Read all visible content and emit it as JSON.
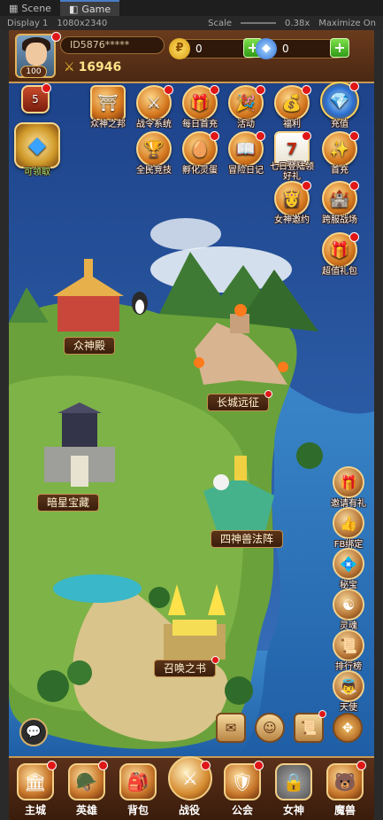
{
  "editor": {
    "tabs": [
      {
        "label": "Scene",
        "icon": "grid-icon"
      },
      {
        "label": "Game",
        "icon": "gamepad-icon"
      }
    ],
    "display": "Display 1",
    "resolution": "1080x2340",
    "scale_label": "Scale",
    "scale_value": "0.38x",
    "maximize": "Maximize On"
  },
  "player": {
    "name": "ID5876*****",
    "level": "100",
    "power": "16946",
    "vip": "5"
  },
  "currency": {
    "gold": "0",
    "diamond": "0"
  },
  "top_icons": [
    {
      "label": "众神之邦",
      "glyph": "⛩"
    },
    {
      "label": "战令系统",
      "glyph": "⚔"
    },
    {
      "label": "每日首充",
      "glyph": "🎁"
    },
    {
      "label": "活动",
      "glyph": "🎉"
    },
    {
      "label": "福利",
      "glyph": "💰"
    },
    {
      "label": "充值",
      "glyph": "💎"
    },
    {
      "label": "全民竞技",
      "glyph": "🏆"
    },
    {
      "label": "孵化灵蛋",
      "glyph": "🥚"
    },
    {
      "label": "冒险日记",
      "glyph": "📖"
    },
    {
      "label": "七日登陆领好礼",
      "glyph": "7"
    },
    {
      "label": "首充",
      "glyph": "✨"
    },
    {
      "label": "女神邀约",
      "glyph": "👸"
    },
    {
      "label": "跨服战场",
      "glyph": "🏰"
    },
    {
      "label": "超值礼包",
      "glyph": "🎁"
    }
  ],
  "left_icons": {
    "vip_label": "5",
    "shop_label": "可领取"
  },
  "map_locations": [
    {
      "label": "众神殿"
    },
    {
      "label": "长城远征"
    },
    {
      "label": "暗星宝藏"
    },
    {
      "label": "四神兽法阵"
    },
    {
      "label": "召唤之书"
    }
  ],
  "side_icons": [
    {
      "label": "邀请有礼",
      "glyph": "🎁"
    },
    {
      "label": "FB绑定",
      "glyph": "👍"
    },
    {
      "label": "秘宝",
      "glyph": "💠"
    },
    {
      "label": "灵魂",
      "glyph": "☯"
    },
    {
      "label": "排行榜",
      "glyph": "📜"
    },
    {
      "label": "天使",
      "glyph": "👼"
    }
  ],
  "bottom_nav": [
    {
      "label": "主城",
      "glyph": "🏛"
    },
    {
      "label": "英雄",
      "glyph": "🪖"
    },
    {
      "label": "背包",
      "glyph": "🎒"
    },
    {
      "label": "战役",
      "glyph": "⚔"
    },
    {
      "label": "公会",
      "glyph": "🛡"
    },
    {
      "label": "女神",
      "glyph": "🔒"
    },
    {
      "label": "魔兽",
      "glyph": "🐻"
    }
  ],
  "colors": {
    "badge_red": "#e01717",
    "panel_brown": "#4b2812",
    "gold_border": "#c99a52",
    "sea_blue": "#2f6fb6",
    "grass_green": "#5a8f2c"
  }
}
